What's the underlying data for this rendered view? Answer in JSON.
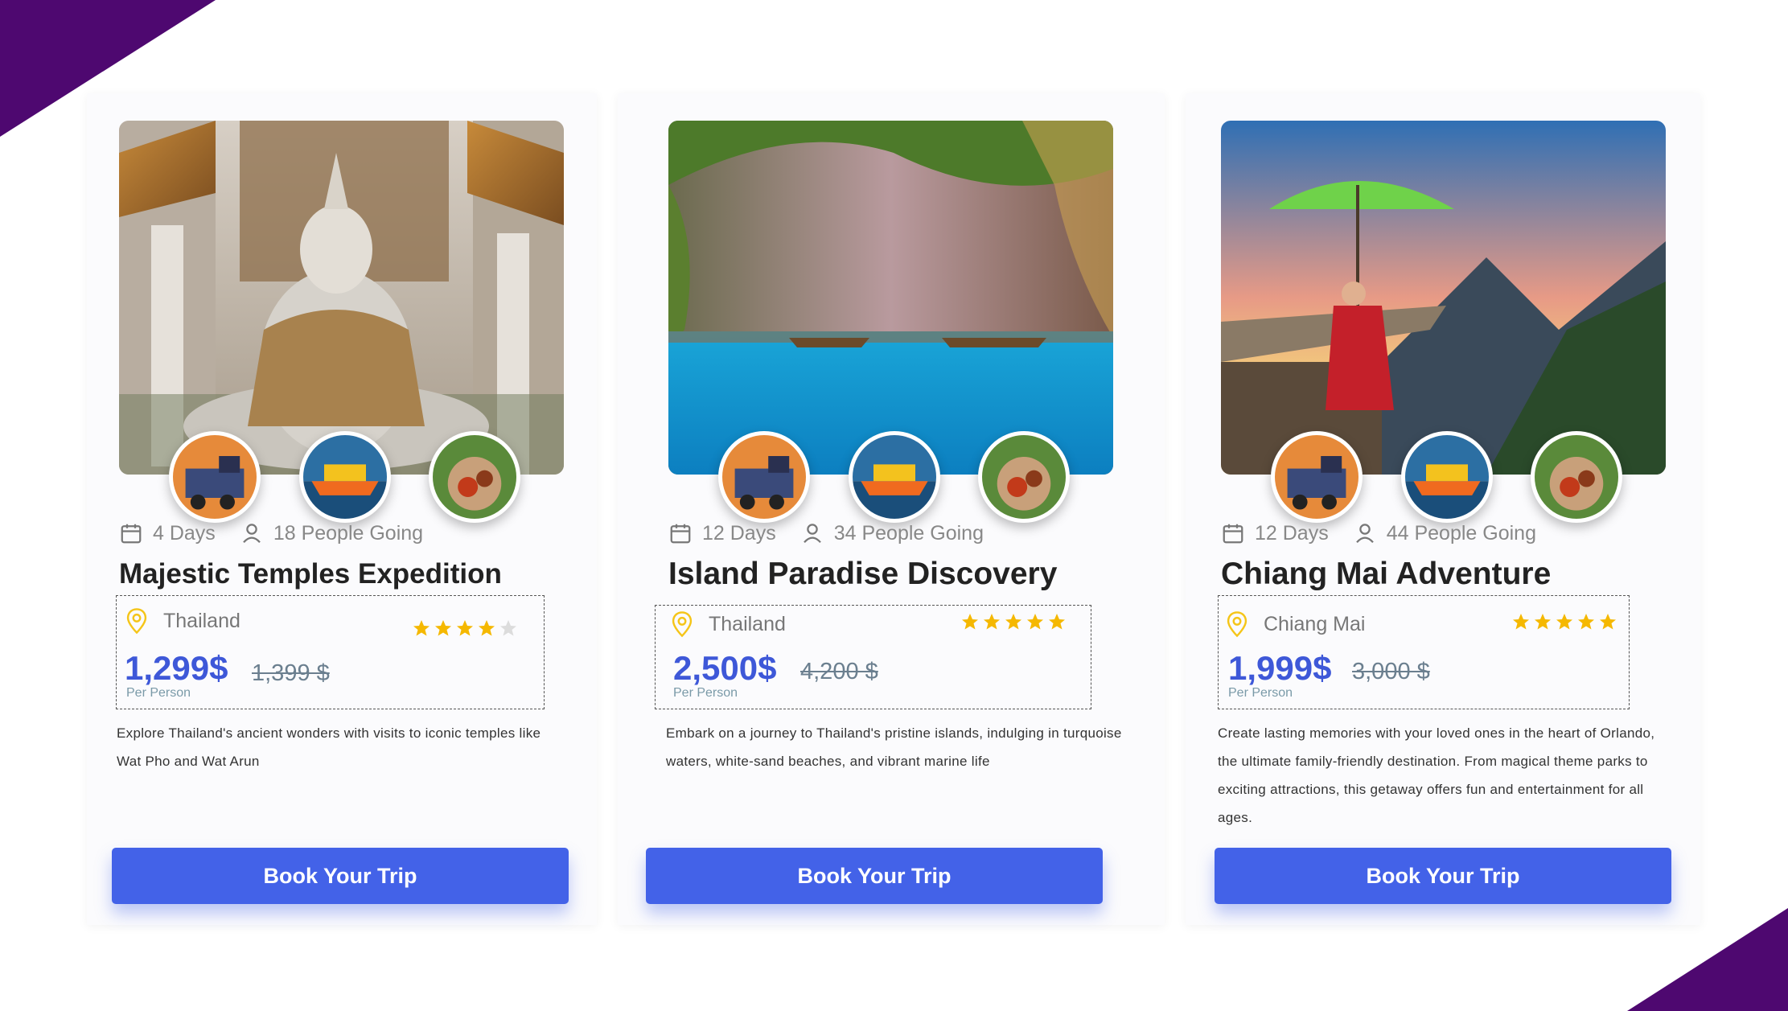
{
  "colors": {
    "accent": "#4362e8",
    "price": "#3e58d8",
    "star": "#f5b800",
    "corner": "#4e0870"
  },
  "cards": [
    {
      "days": "4 Days",
      "people": "18 People Going",
      "title": "Majestic Temples Expedition",
      "location": "Thailand",
      "rating": 4,
      "price": "1,299$",
      "old_price": "1,399 $",
      "per_person": "Per Person",
      "description": "Explore Thailand's ancient wonders with visits to iconic temples like Wat Pho and Wat Arun",
      "button": "Book Your Trip",
      "icons": [
        "calendar-icon",
        "person-icon",
        "location-pin-icon"
      ]
    },
    {
      "days": "12 Days",
      "people": "34 People Going",
      "title": "Island Paradise Discovery",
      "location": "Thailand",
      "rating": 5,
      "price": "2,500$",
      "old_price": "4,200 $",
      "per_person": "Per Person",
      "description": "Embark on a journey to Thailand's pristine islands, indulging in turquoise waters, white-sand beaches, and vibrant marine life",
      "button": "Book Your Trip",
      "icons": [
        "calendar-icon",
        "person-icon",
        "location-pin-icon"
      ]
    },
    {
      "days": "12 Days",
      "people": "44 People Going",
      "title": "Chiang Mai Adventure",
      "location": "Chiang Mai",
      "rating": 5,
      "price": "1,999$",
      "old_price": "3,000 $",
      "per_person": "Per Person",
      "description": "Create lasting memories with your loved ones in the heart of Orlando, the ultimate family-friendly destination. From magical theme parks to exciting attractions, this getaway offers fun and entertainment for all ages.",
      "button": "Book Your Trip",
      "icons": [
        "calendar-icon",
        "person-icon",
        "location-pin-icon"
      ]
    }
  ]
}
